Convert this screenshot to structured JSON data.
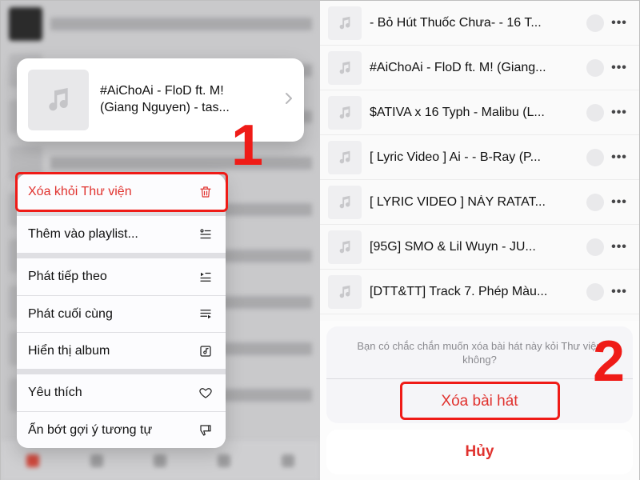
{
  "card": {
    "title_line1": "#AiChoAi - FloD ft. M!",
    "title_line2": "(Giang Nguyen) - tas..."
  },
  "menu": {
    "delete": "Xóa khỏi Thư viện",
    "addPlaylist": "Thêm vào playlist...",
    "playNext": "Phát tiếp theo",
    "playLast": "Phát cuối cùng",
    "showAlbum": "Hiển thị album",
    "love": "Yêu thích",
    "dislike": "Ẩn bớt gợi ý tương tự"
  },
  "tracks": [
    "- Bỏ Hút Thuốc Chưa- - 16 T...",
    "#AiChoAi - FloD ft. M! (Giang...",
    "$ATIVA x 16 Typh - Malibu (L...",
    "[ Lyric Video ] Ai - - B-Ray (P...",
    "[ LYRIC VIDEO ] NÀY RATAT...",
    "[95G] SMO & Lil Wuyn - JU...",
    "[DTT&TT] Track 7. Phép Màu..."
  ],
  "sheet": {
    "message": "Bạn có chắc chắn muốn xóa bài hát này kỏi Thư viện không?",
    "delete": "Xóa bài hát",
    "cancel": "Hủy"
  },
  "annotations": {
    "step1": "1",
    "step2": "2"
  }
}
